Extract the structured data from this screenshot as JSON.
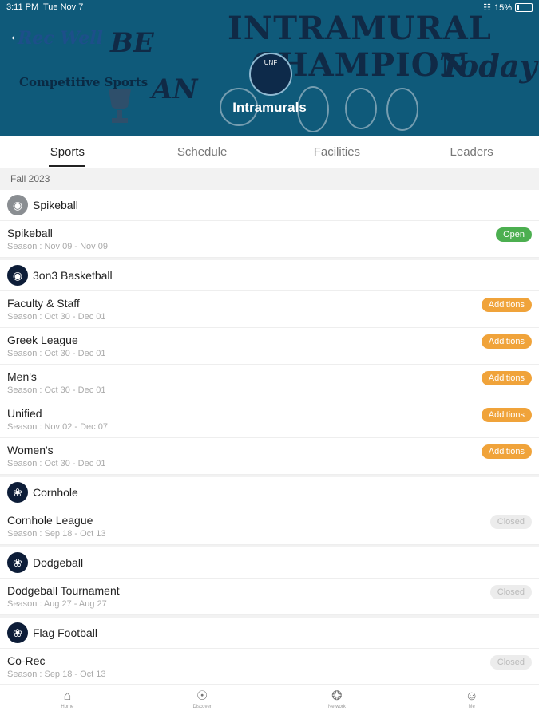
{
  "status_bar": {
    "time": "3:11 PM",
    "date": "Tue Nov 7",
    "battery": "15%"
  },
  "header": {
    "title": "Intramurals",
    "art": {
      "recwell": "Rec Well",
      "competitive": "Competitive Sports",
      "be": "BE",
      "an": "AN",
      "intramural": "INTRAMURAL",
      "champion": "CHAMPION",
      "today": "Today",
      "logo_text": "UNF"
    }
  },
  "tabs": [
    {
      "label": "Sports",
      "active": true
    },
    {
      "label": "Schedule",
      "active": false
    },
    {
      "label": "Facilities",
      "active": false
    },
    {
      "label": "Leaders",
      "active": false
    }
  ],
  "season_label": "Fall 2023",
  "sports": [
    {
      "name": "Spikeball",
      "icon": "spikeball-icon",
      "leagues": [
        {
          "name": "Spikeball",
          "season": "Season : Nov 09 - Nov 09",
          "status": "Open",
          "status_type": "open"
        }
      ]
    },
    {
      "name": "3on3 Basketball",
      "icon": "basketball-icon",
      "leagues": [
        {
          "name": "Faculty & Staff",
          "season": "Season : Oct 30 - Dec 01",
          "status": "Additions",
          "status_type": "additions"
        },
        {
          "name": "Greek League",
          "season": "Season : Oct 30 - Dec 01",
          "status": "Additions",
          "status_type": "additions"
        },
        {
          "name": "Men's",
          "season": "Season : Oct 30 - Dec 01",
          "status": "Additions",
          "status_type": "additions"
        },
        {
          "name": "Unified",
          "season": "Season : Nov 02 - Dec 07",
          "status": "Additions",
          "status_type": "additions"
        },
        {
          "name": "Women's",
          "season": "Season : Oct 30 - Dec 01",
          "status": "Additions",
          "status_type": "additions"
        }
      ]
    },
    {
      "name": "Cornhole",
      "icon": "cornhole-icon",
      "leagues": [
        {
          "name": "Cornhole League",
          "season": "Season : Sep 18 - Oct 13",
          "status": "Closed",
          "status_type": "closed"
        }
      ]
    },
    {
      "name": "Dodgeball",
      "icon": "dodgeball-icon",
      "leagues": [
        {
          "name": "Dodgeball Tournament",
          "season": "Season : Aug 27 - Aug 27",
          "status": "Closed",
          "status_type": "closed"
        }
      ]
    },
    {
      "name": "Flag Football",
      "icon": "football-icon",
      "leagues": [
        {
          "name": "Co-Rec",
          "season": "Season : Sep 18 - Oct 13",
          "status": "Closed",
          "status_type": "closed"
        }
      ]
    }
  ],
  "bottom_nav": [
    {
      "label": "Home",
      "icon": "home-icon"
    },
    {
      "label": "Discover",
      "icon": "compass-icon"
    },
    {
      "label": "Network",
      "icon": "network-icon"
    },
    {
      "label": "Me",
      "icon": "user-icon"
    }
  ],
  "colors": {
    "banner": "#0f5a7a",
    "open": "#4caf50",
    "additions": "#f0a33a",
    "closed": "#ececec"
  }
}
